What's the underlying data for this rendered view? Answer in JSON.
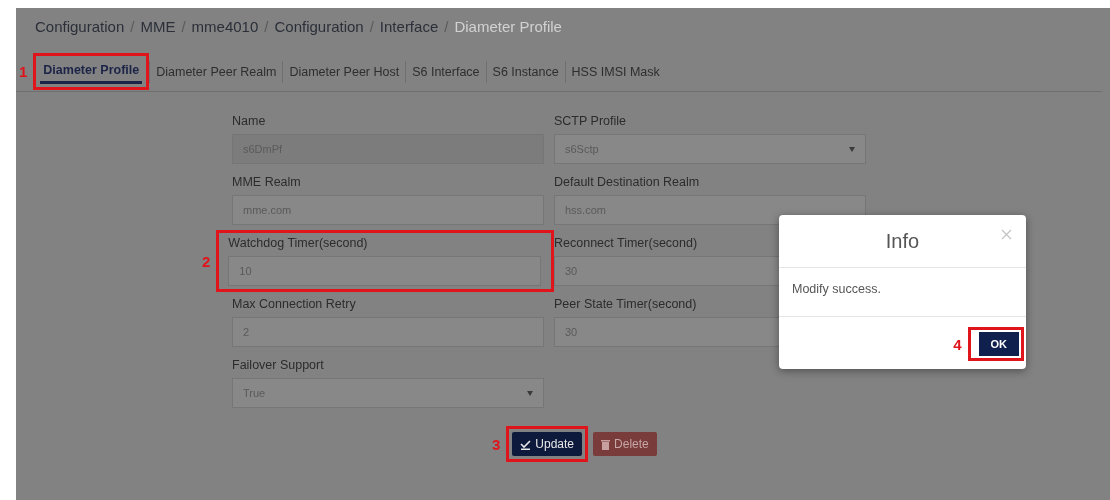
{
  "breadcrumb": [
    {
      "label": "Configuration",
      "current": false
    },
    {
      "separator": "/",
      "label": "MME",
      "current": false
    },
    {
      "separator": "/",
      "label": "mme4010",
      "current": false
    },
    {
      "separator": "/",
      "label": "Configuration",
      "current": false
    },
    {
      "separator": "/",
      "label": "Interface",
      "current": false
    },
    {
      "separator": "/",
      "label": "Diameter Profile",
      "current": true
    }
  ],
  "tabs": [
    {
      "label": "Diameter Profile",
      "selected": true,
      "annotation": "1"
    },
    {
      "label": "Diameter Peer Realm",
      "selected": false
    },
    {
      "label": "Diameter Peer Host",
      "selected": false
    },
    {
      "label": "S6 Interface",
      "selected": false
    },
    {
      "label": "S6 Instance",
      "selected": false
    },
    {
      "label": "HSS IMSI Mask",
      "selected": false
    }
  ],
  "form": {
    "fields": [
      {
        "label": "Name",
        "kind": "text",
        "value": "s6DmPf",
        "disabled": true
      },
      {
        "label": "SCTP Profile",
        "kind": "select",
        "value": "s6Sctp",
        "disabled": false
      },
      {
        "label": "MME Realm",
        "kind": "text",
        "value": "mme.com",
        "disabled": false
      },
      {
        "label": "Default Destination Realm",
        "kind": "text",
        "value": "hss.com",
        "disabled": false
      },
      {
        "label": "Watchdog Timer(second)",
        "kind": "text",
        "value": "10",
        "disabled": false,
        "annotation": "2"
      },
      {
        "label": "Reconnect Timer(second)",
        "kind": "text",
        "value": "30",
        "disabled": false
      },
      {
        "label": "Max Connection Retry",
        "kind": "text",
        "value": "2",
        "disabled": false
      },
      {
        "label": "Peer State Timer(second)",
        "kind": "text",
        "value": "30",
        "disabled": false
      },
      {
        "label": "Failover Support",
        "kind": "select",
        "value": "True",
        "disabled": false
      }
    ],
    "buttons": [
      {
        "label": "Update",
        "kind": "primary",
        "annotation": "3"
      },
      {
        "label": "Delete",
        "kind": "danger"
      }
    ]
  },
  "dialog": {
    "title": "Info",
    "message": "Modify success.",
    "ok": {
      "label": "OK",
      "annotation": "4"
    }
  }
}
